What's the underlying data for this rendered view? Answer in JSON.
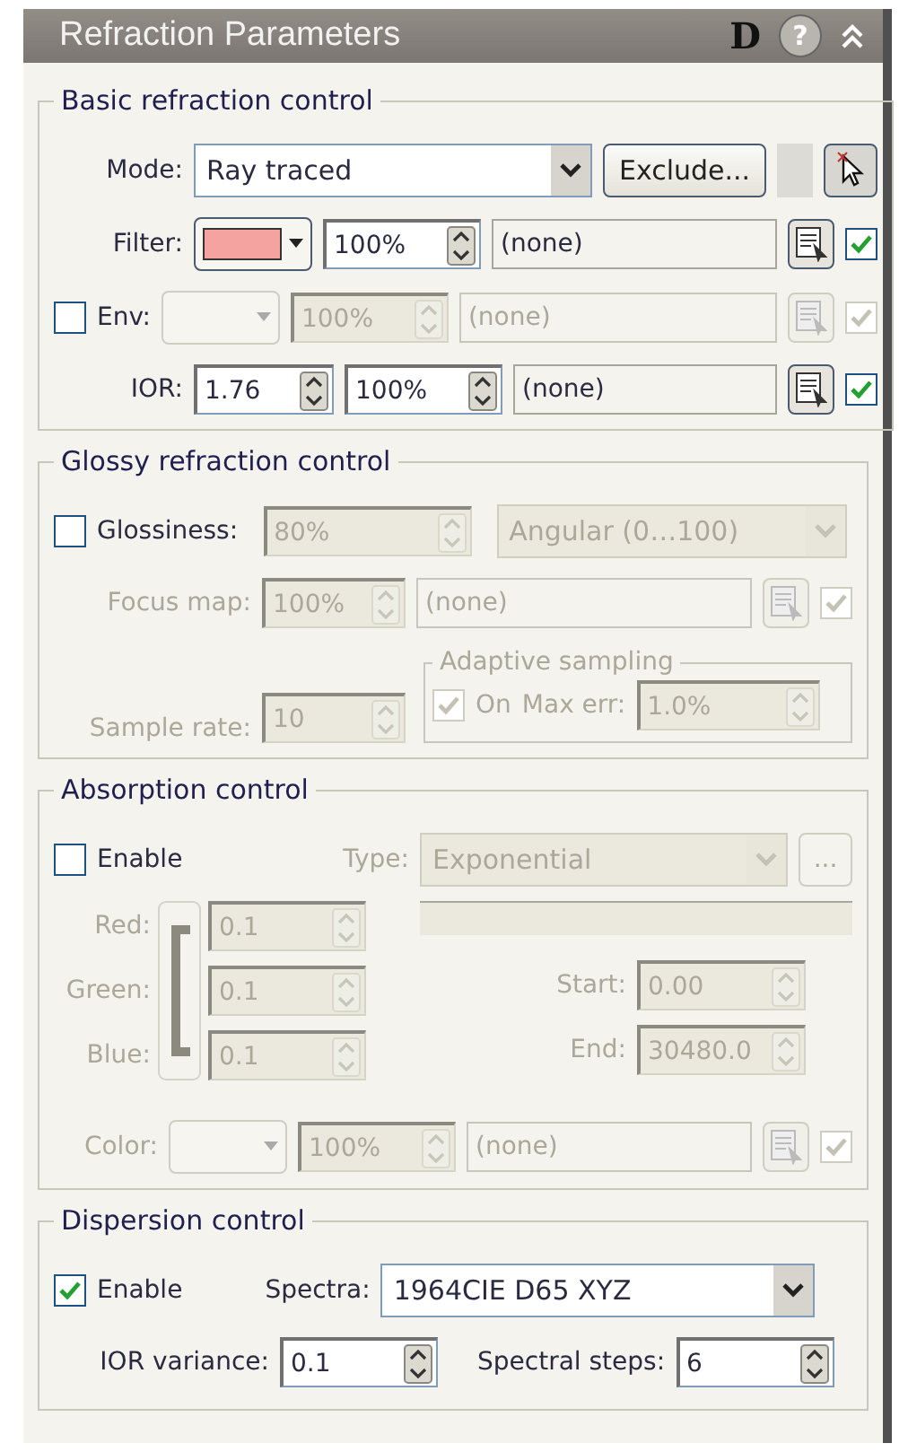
{
  "title": "Refraction Parameters",
  "title_buttons": [
    "D",
    "?"
  ],
  "basic": {
    "label": "Basic refraction control",
    "mode": {
      "label": "Mode:",
      "value": "Ray traced",
      "button": "Exclude..."
    },
    "filter": {
      "label": "Filter:",
      "color": "#f4a3a0",
      "amount": "100%",
      "map": "(none)",
      "map_checked": true
    },
    "env": {
      "label": "Env:",
      "checked": false,
      "amount": "100%",
      "map": "(none)",
      "map_checked": true
    },
    "ior": {
      "label": "IOR:",
      "value": "1.76",
      "amount": "100%",
      "map": "(none)",
      "map_checked": true
    }
  },
  "glossy": {
    "label": "Glossiness:",
    "group": "Glossy refraction control",
    "checked": false,
    "value": "80%",
    "type": "Angular (0…100)",
    "focus": {
      "label": "Focus map:",
      "amount": "100%",
      "map": "(none)",
      "map_checked": true
    },
    "sample": {
      "label": "Sample rate:",
      "value": "10"
    },
    "adaptive": {
      "label": "Adaptive sampling",
      "on_label": "On",
      "on_checked": true,
      "maxerr_label": "Max err:",
      "maxerr": "1.0%"
    }
  },
  "absorption": {
    "group": "Absorption control",
    "enable": {
      "label": "Enable",
      "checked": false
    },
    "type_label": "Type:",
    "type": "Exponential",
    "more": "...",
    "channels": [
      {
        "label": "Red:",
        "value": "0.1"
      },
      {
        "label": "Green:",
        "value": "0.1"
      },
      {
        "label": "Blue:",
        "value": "0.1"
      }
    ],
    "start": {
      "label": "Start:",
      "value": "0.00"
    },
    "end": {
      "label": "End:",
      "value": "30480.0"
    },
    "color": {
      "label": "Color:",
      "amount": "100%",
      "map": "(none)",
      "map_checked": true
    }
  },
  "dispersion": {
    "group": "Dispersion control",
    "enable": {
      "label": "Enable",
      "checked": true
    },
    "spectra_label": "Spectra:",
    "spectra": "1964CIE D65 XYZ",
    "ior_variance": {
      "label": "IOR variance:",
      "value": "0.1"
    },
    "steps": {
      "label": "Spectral steps:",
      "value": "6"
    }
  }
}
